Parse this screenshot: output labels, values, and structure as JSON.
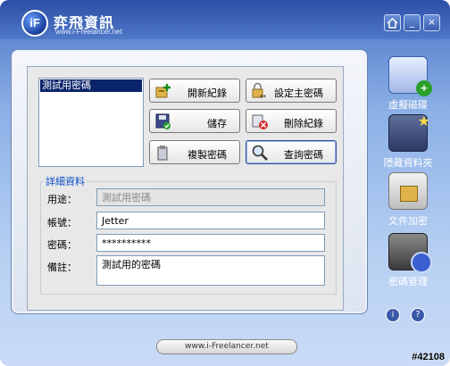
{
  "window": {
    "title": "弈飛資訊",
    "subtitle": "www.i-Freelancer.net",
    "logo_text": "iF",
    "controls": [
      {
        "icon": "home-icon"
      },
      {
        "icon": "minimize-icon",
        "glyph": "_"
      },
      {
        "icon": "close-icon",
        "glyph": "×"
      }
    ]
  },
  "list": {
    "items": [
      "測試用密碼"
    ],
    "selected_index": 0
  },
  "buttons": {
    "add_record": "開新紀錄",
    "set_master_password": "設定主密碼",
    "save": "儲存",
    "delete_record": "刪除紀錄",
    "copy_password": "複製密碼",
    "query_password": "查詢密碼"
  },
  "details": {
    "group_title": "詳細資料",
    "purpose_label": "用途：",
    "purpose_value": "測試用密碼",
    "account_label": "帳號：",
    "account_value": "Jetter",
    "password_label": "密碼：",
    "password_value": "**********",
    "note_label": "備註：",
    "note_value": "測試用的密碼"
  },
  "sidebar": {
    "items": [
      {
        "label": "虛擬磁碟",
        "icon": "virtual-disk-icon"
      },
      {
        "label": "隱藏資料夾",
        "icon": "hidden-folder-icon"
      },
      {
        "label": "文件加密",
        "icon": "file-encrypt-icon"
      },
      {
        "label": "密碼管理",
        "icon": "password-manager-icon"
      }
    ]
  },
  "footer": {
    "url": "www.i-Freelancer.net",
    "help_glyph": "?",
    "info_glyph": "i",
    "badge": "#42108"
  },
  "colors": {
    "title_bar": "#2c4fa6",
    "selection": "#0a246a",
    "group_title": "#0a50c8"
  }
}
